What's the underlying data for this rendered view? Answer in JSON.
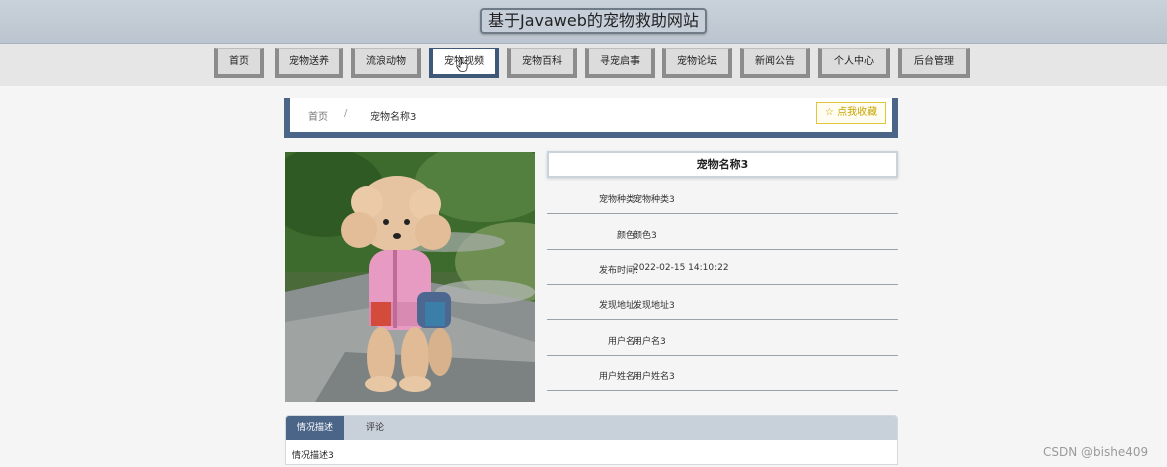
{
  "header": {
    "site_title": "基于Javaweb的宠物救助网站"
  },
  "nav": {
    "items": [
      {
        "label": "首页"
      },
      {
        "label": "宠物送养"
      },
      {
        "label": "流浪动物"
      },
      {
        "label": "宠物视频",
        "active": true
      },
      {
        "label": "宠物百科"
      },
      {
        "label": "寻宠启事"
      },
      {
        "label": "宠物论坛"
      },
      {
        "label": "新闻公告"
      },
      {
        "label": "个人中心"
      },
      {
        "label": "后台管理"
      }
    ]
  },
  "breadcrumb": {
    "home": "首页",
    "separator": "/",
    "current": "宠物名称3"
  },
  "favorite_button": {
    "icon": "star-icon",
    "label": "☆ 点我收藏"
  },
  "detail": {
    "title": "宠物名称3",
    "rows": [
      {
        "label": "宠物种类:",
        "value": "宠物种类3"
      },
      {
        "label": "颜色:",
        "value": "颜色3"
      },
      {
        "label": "发布时间:",
        "value": "2022-02-15 14:10:22"
      },
      {
        "label": "发现地址:",
        "value": "发现地址3"
      },
      {
        "label": "用户名:",
        "value": "用户名3"
      },
      {
        "label": "用户姓名:",
        "value": "用户姓名3"
      }
    ]
  },
  "tabs": {
    "items": [
      {
        "label": "情况描述",
        "active": true
      },
      {
        "label": "评论",
        "active": false
      }
    ],
    "content": "情况描述3"
  },
  "watermark": "CSDN @bishe409",
  "colors": {
    "accent": "#4b6588",
    "header_bg": "#c9d1da",
    "favorite": "#e0c63a"
  }
}
